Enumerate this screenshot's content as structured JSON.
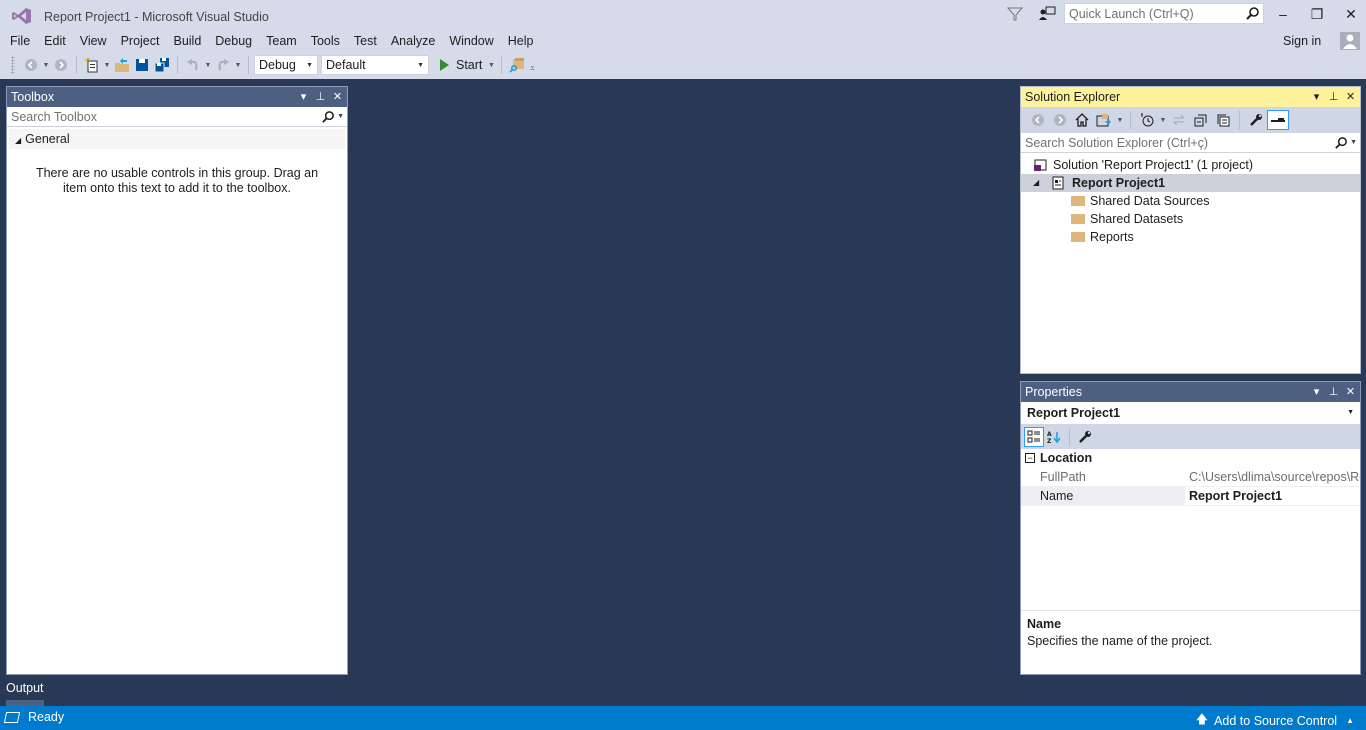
{
  "window": {
    "title": "Report Project1 - Microsoft Visual Studio",
    "quick_launch_placeholder": "Quick Launch (Ctrl+Q)",
    "minimize": "–",
    "restore": "❐",
    "close": "✕",
    "sign_in": "Sign in"
  },
  "menu": [
    "File",
    "Edit",
    "View",
    "Project",
    "Build",
    "Debug",
    "Team",
    "Tools",
    "Test",
    "Analyze",
    "Window",
    "Help"
  ],
  "toolbar": {
    "config": "Debug",
    "platform": "Default",
    "start": "Start",
    "icons": [
      "back-icon",
      "forward-icon",
      "new-project-icon",
      "open-file-icon",
      "save-icon",
      "save-all-icon",
      "undo-icon",
      "redo-icon",
      "start-icon",
      "find-in-files-icon"
    ]
  },
  "toolbox": {
    "title": "Toolbox",
    "search_placeholder": "Search Toolbox",
    "group": "General",
    "empty_message": "There are no usable controls in this group. Drag an item onto this text to add it to the toolbox."
  },
  "solution_explorer": {
    "title": "Solution Explorer",
    "search_placeholder": "Search Solution Explorer (Ctrl+ç)",
    "tree": [
      {
        "label": "Solution 'Report Project1' (1 project)",
        "icon": "solution-icon",
        "level": 0
      },
      {
        "label": "Report Project1",
        "icon": "project-icon",
        "level": 1,
        "selected": true,
        "expanded": true
      },
      {
        "label": "Shared Data Sources",
        "icon": "folder-icon",
        "level": 2
      },
      {
        "label": "Shared Datasets",
        "icon": "folder-icon",
        "level": 2
      },
      {
        "label": "Reports",
        "icon": "folder-icon",
        "level": 2
      }
    ]
  },
  "properties": {
    "title": "Properties",
    "object": "Report Project1",
    "category": "Location",
    "rows": [
      {
        "name": "FullPath",
        "value": "C:\\Users\\dlima\\source\\repos\\Re",
        "readonly": true
      },
      {
        "name": "Name",
        "value": "Report Project1",
        "selected": true
      }
    ],
    "description_title": "Name",
    "description_text": "Specifies the name of the project."
  },
  "output_tab": "Output",
  "status": {
    "text": "Ready",
    "source_control": "Add to Source Control"
  },
  "colors": {
    "accent": "#007acc",
    "background": "#293955",
    "active_header": "#fff29d",
    "inactive_header": "#4d6082"
  }
}
